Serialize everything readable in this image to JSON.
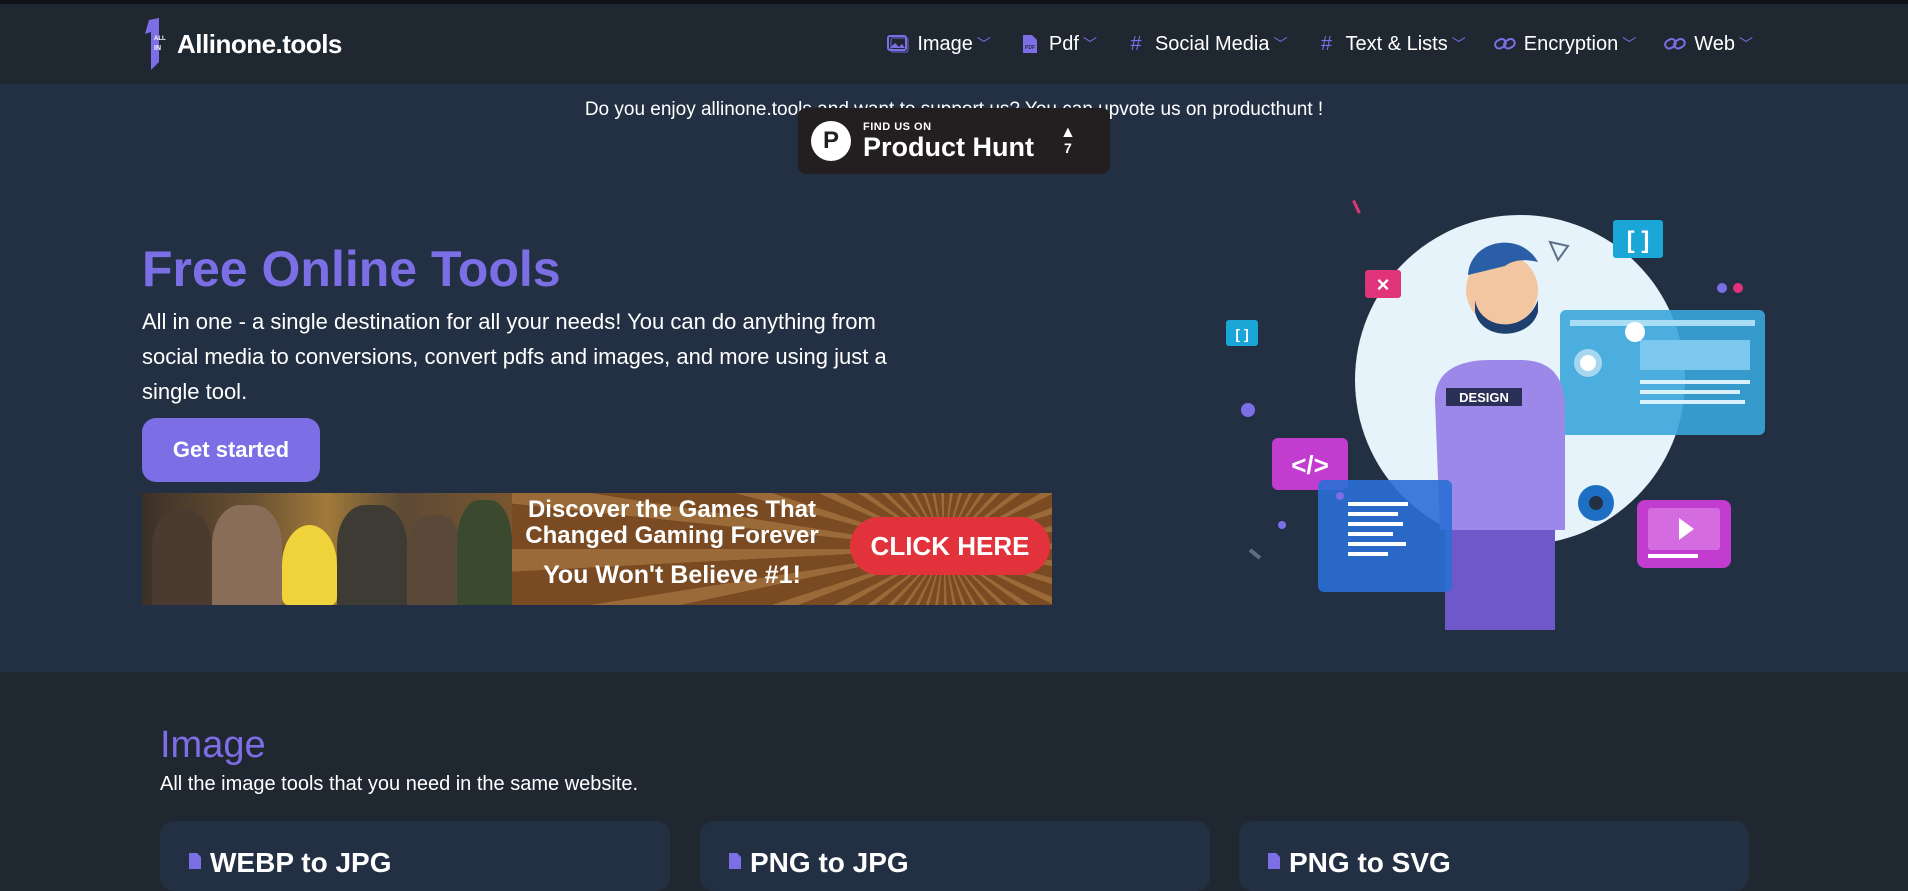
{
  "header": {
    "brand": "Allinone.tools",
    "nav": [
      {
        "label": "Image",
        "icon": "image-icon"
      },
      {
        "label": "Pdf",
        "icon": "pdf-file-icon"
      },
      {
        "label": "Social Media",
        "icon": "hash-icon"
      },
      {
        "label": "Text & Lists",
        "icon": "hash-icon"
      },
      {
        "label": "Encryption",
        "icon": "link-icon"
      },
      {
        "label": "Web",
        "icon": "link-icon"
      }
    ]
  },
  "support": {
    "text": "Do you enjoy allinone.tools and want to support us? You can upvote us on producthunt !",
    "badge_small": "FIND US ON",
    "badge_big": "Product Hunt",
    "badge_votes": "7"
  },
  "hero": {
    "title": "Free Online Tools",
    "description": "All in one - a single destination for all your needs! You can do anything from social media to conversions, convert pdfs and images, and more using just a single tool.",
    "cta": "Get started"
  },
  "ad": {
    "line1": "Discover the Games That",
    "line2": "Changed Gaming Forever",
    "line3": "You Won't Believe #1!",
    "button": "CLICK HERE"
  },
  "illustration": {
    "shirt_text": "DESIGN"
  },
  "section": {
    "title": "Image",
    "description": "All the image tools that you need in the same website.",
    "cards": [
      {
        "title": "WEBP to JPG"
      },
      {
        "title": "PNG to JPG"
      },
      {
        "title": "PNG to SVG"
      }
    ]
  },
  "colors": {
    "accent": "#7c6fe6",
    "header_bg": "#1f2731",
    "hero_bg": "#233044",
    "ad_button": "#e2333d"
  }
}
